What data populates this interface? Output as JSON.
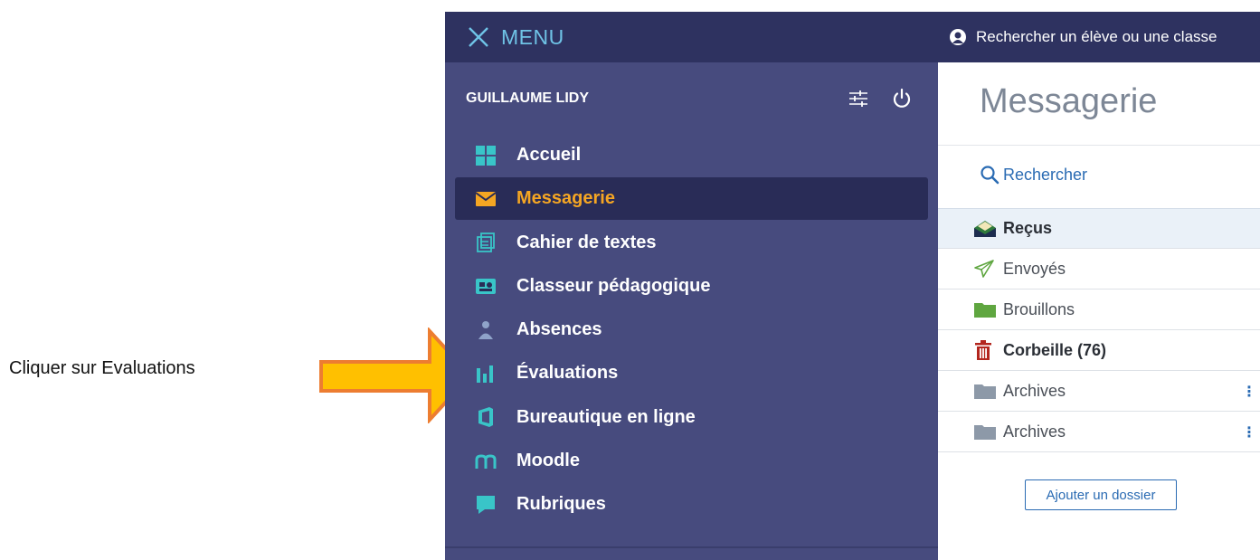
{
  "instruction": "Cliquer sur Evaluations",
  "menu": {
    "label": "MENU"
  },
  "user": {
    "name": "GUILLAUME LIDY"
  },
  "nav": [
    {
      "label": "Accueil",
      "icon": "grid-icon"
    },
    {
      "label": "Messagerie",
      "icon": "envelope-icon",
      "active": true
    },
    {
      "label": "Cahier de textes",
      "icon": "notebook-icon"
    },
    {
      "label": "Classeur pédagogique",
      "icon": "binder-icon"
    },
    {
      "label": "Absences",
      "icon": "person-icon"
    },
    {
      "label": "Évaluations",
      "icon": "bar-chart-icon"
    },
    {
      "label": "Bureautique en ligne",
      "icon": "office-icon"
    },
    {
      "label": "Moodle",
      "icon": "moodle-icon"
    },
    {
      "label": "Rubriques",
      "icon": "chat-icon"
    }
  ],
  "search_bar": {
    "text": "Rechercher un élève ou une classe"
  },
  "panel": {
    "title": "Messagerie",
    "search_label": "Rechercher",
    "folders": [
      {
        "label": "Reçus",
        "icon": "inbox-icon"
      },
      {
        "label": "Envoyés",
        "icon": "send-icon"
      },
      {
        "label": "Brouillons",
        "icon": "folder-icon"
      },
      {
        "label": "Corbeille (76)",
        "icon": "trash-icon"
      },
      {
        "label": "Archives",
        "icon": "folder-icon"
      },
      {
        "label": "Archives",
        "icon": "folder-icon"
      }
    ],
    "add_folder_label": "Ajouter un dossier"
  },
  "colors": {
    "sidebar": "#474b7e",
    "menu_bar": "#2e3260",
    "active_text": "#f5a623",
    "accent_teal": "#39c5c8",
    "link_blue": "#2a6bb3",
    "arrow_fill": "#ffc000",
    "arrow_stroke": "#ed7d31"
  }
}
